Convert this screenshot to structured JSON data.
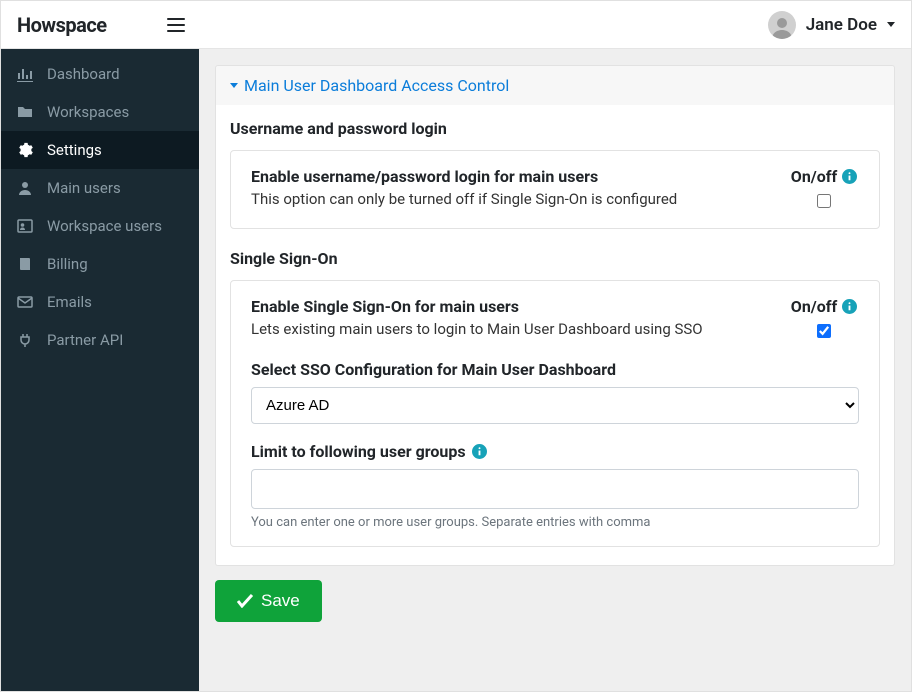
{
  "header": {
    "logo": "Howspace",
    "user_name": "Jane Doe"
  },
  "sidebar": {
    "items": [
      {
        "id": "dashboard",
        "label": "Dashboard",
        "icon": "chart"
      },
      {
        "id": "workspaces",
        "label": "Workspaces",
        "icon": "folder"
      },
      {
        "id": "settings",
        "label": "Settings",
        "icon": "gear"
      },
      {
        "id": "main-users",
        "label": "Main users",
        "icon": "user"
      },
      {
        "id": "workspace-users",
        "label": "Workspace users",
        "icon": "id"
      },
      {
        "id": "billing",
        "label": "Billing",
        "icon": "book"
      },
      {
        "id": "emails",
        "label": "Emails",
        "icon": "mail"
      },
      {
        "id": "partner-api",
        "label": "Partner API",
        "icon": "plug"
      }
    ],
    "active": "settings"
  },
  "accordion": {
    "title": "Main User Dashboard Access Control"
  },
  "section_username": {
    "title": "Username and password login",
    "option_label": "Enable username/password login for main users",
    "option_desc": "This option can only be turned off if Single Sign-On is configured",
    "switch_label": "On/off",
    "checked": false
  },
  "section_sso": {
    "title": "Single Sign-On",
    "option_label": "Enable Single Sign-On for main users",
    "option_desc": "Lets existing main users to login to Main User Dashboard using SSO",
    "switch_label": "On/off",
    "checked": true,
    "config_label": "Select SSO Configuration for Main User Dashboard",
    "config_selected": "Azure AD",
    "groups_label": "Limit to following user groups",
    "groups_value": "",
    "groups_help": "You can enter one or more user groups. Separate entries with comma"
  },
  "save_label": "Save"
}
